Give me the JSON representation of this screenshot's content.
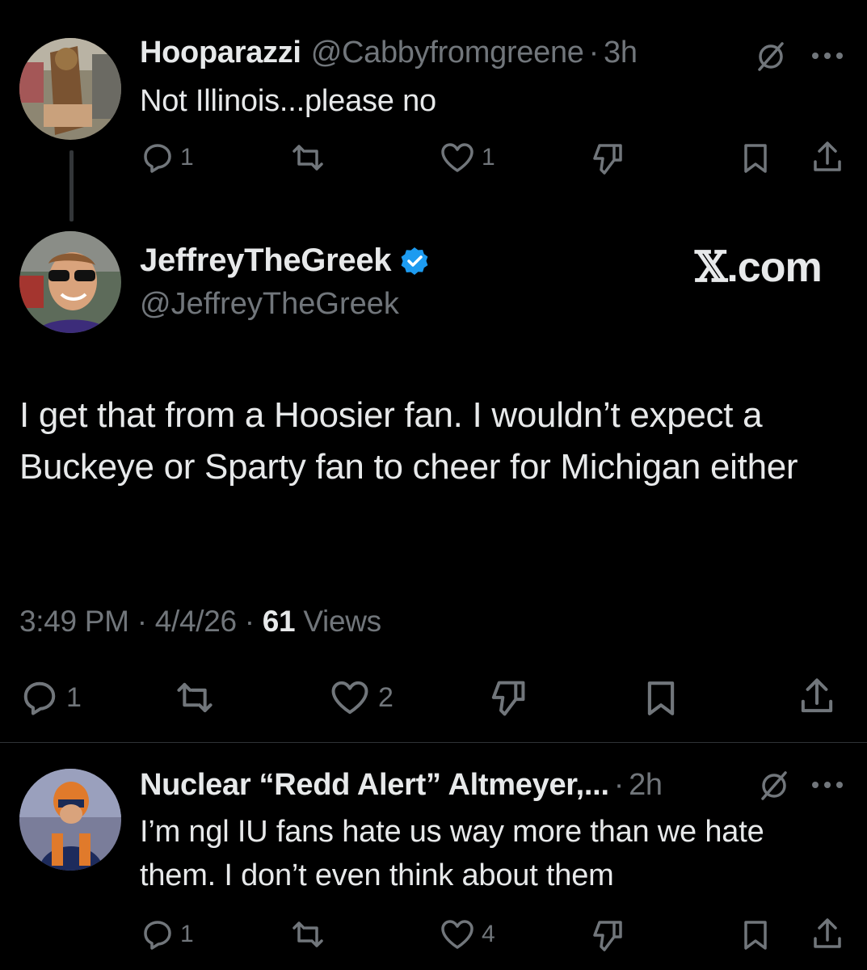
{
  "reply1": {
    "display_name": "Hooparazzi",
    "handle": "@Cabbyfromgreene",
    "separator": "·",
    "time": "3h",
    "text": "Not Illinois...please no",
    "reply_count": "1",
    "like_count": "1",
    "icons": [
      "reply-icon",
      "repost-icon",
      "like-icon",
      "dislike-icon",
      "bookmark-icon",
      "share-icon",
      "grok-icon",
      "more-icon"
    ]
  },
  "main_tweet": {
    "display_name": "JeffreyTheGreek",
    "handle": "@JeffreyTheGreek",
    "watermark_x": "𝕏",
    "watermark_com": ".com",
    "text": "I get that from a Hoosier fan. I wouldn’t expect a Buckeye or Sparty fan to cheer for Michigan either",
    "time": "3:49 PM",
    "date": "4/4/26",
    "separator": "·",
    "views_count": "61",
    "views_label": "Views",
    "reply_count": "1",
    "like_count": "2",
    "verified_color": "#1d9bf0"
  },
  "reply2": {
    "display_name": "Nuclear “Redd Alert” Altmeyer,...",
    "separator": "·",
    "time": "2h",
    "text_line1": "I’m ngl IU fans hate us way more than we hate",
    "text_line2": "them. I don’t even think about them",
    "reply_count": "1",
    "like_count": "4"
  },
  "colors": {
    "background": "#000000",
    "primary_text": "#e7e9ea",
    "secondary_text": "#71767b",
    "divider": "#2f3336",
    "accent": "#1d9bf0"
  }
}
